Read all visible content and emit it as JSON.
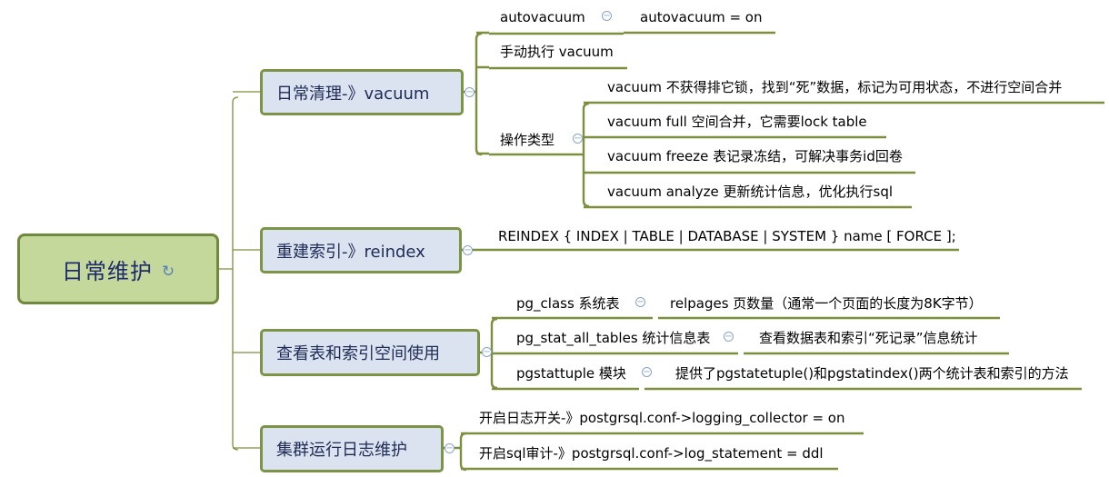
{
  "root": {
    "label": "日常维护",
    "icon": "refresh-icon"
  },
  "branches": [
    {
      "label": "日常清理-》vacuum",
      "children": [
        {
          "label": "autovacuum",
          "children": [
            "autovacuum = on"
          ]
        },
        {
          "label": "手动执行 vacuum"
        },
        {
          "label": "操作类型",
          "children": [
            "vacuum 不获得排它锁，找到“死”数据，标记为可用状态，不进行空间合并",
            "vacuum full  空间合并，它需要lock table",
            "vacuum freeze 表记录冻结，可解决事务id回卷",
            "vacuum analyze 更新统计信息，优化执行sql"
          ]
        }
      ]
    },
    {
      "label": "重建索引-》reindex",
      "children": [
        {
          "label": "REINDEX { INDEX | TABLE | DATABASE | SYSTEM } name [ FORCE ];"
        }
      ]
    },
    {
      "label": "查看表和索引空间使用",
      "children": [
        {
          "label": "pg_class 系统表",
          "children": [
            "relpages 页数量（通常一个页面的长度为8K字节）"
          ]
        },
        {
          "label": "pg_stat_all_tables 统计信息表",
          "children": [
            "查看数据表和索引“死记录”信息统计"
          ]
        },
        {
          "label": "pgstattuple 模块",
          "children": [
            "提供了pgstatetuple()和pgstatindex()两个统计表和索引的方法"
          ]
        }
      ]
    },
    {
      "label": "集群运行日志维护",
      "children": [
        {
          "label": "开启日志开关-》postgrsql.conf->logging_collector = on"
        },
        {
          "label": "开启sql审计-》postgrsql.conf->log_statement = ddl"
        }
      ]
    }
  ],
  "colors": {
    "root_fill": "#c4d89c",
    "root_border": "#6f8a3c",
    "topic_fill": "#dae3ef",
    "topic_border": "#7b9446",
    "line": "#7b8f3e",
    "collapse": "#8ba3c6"
  }
}
